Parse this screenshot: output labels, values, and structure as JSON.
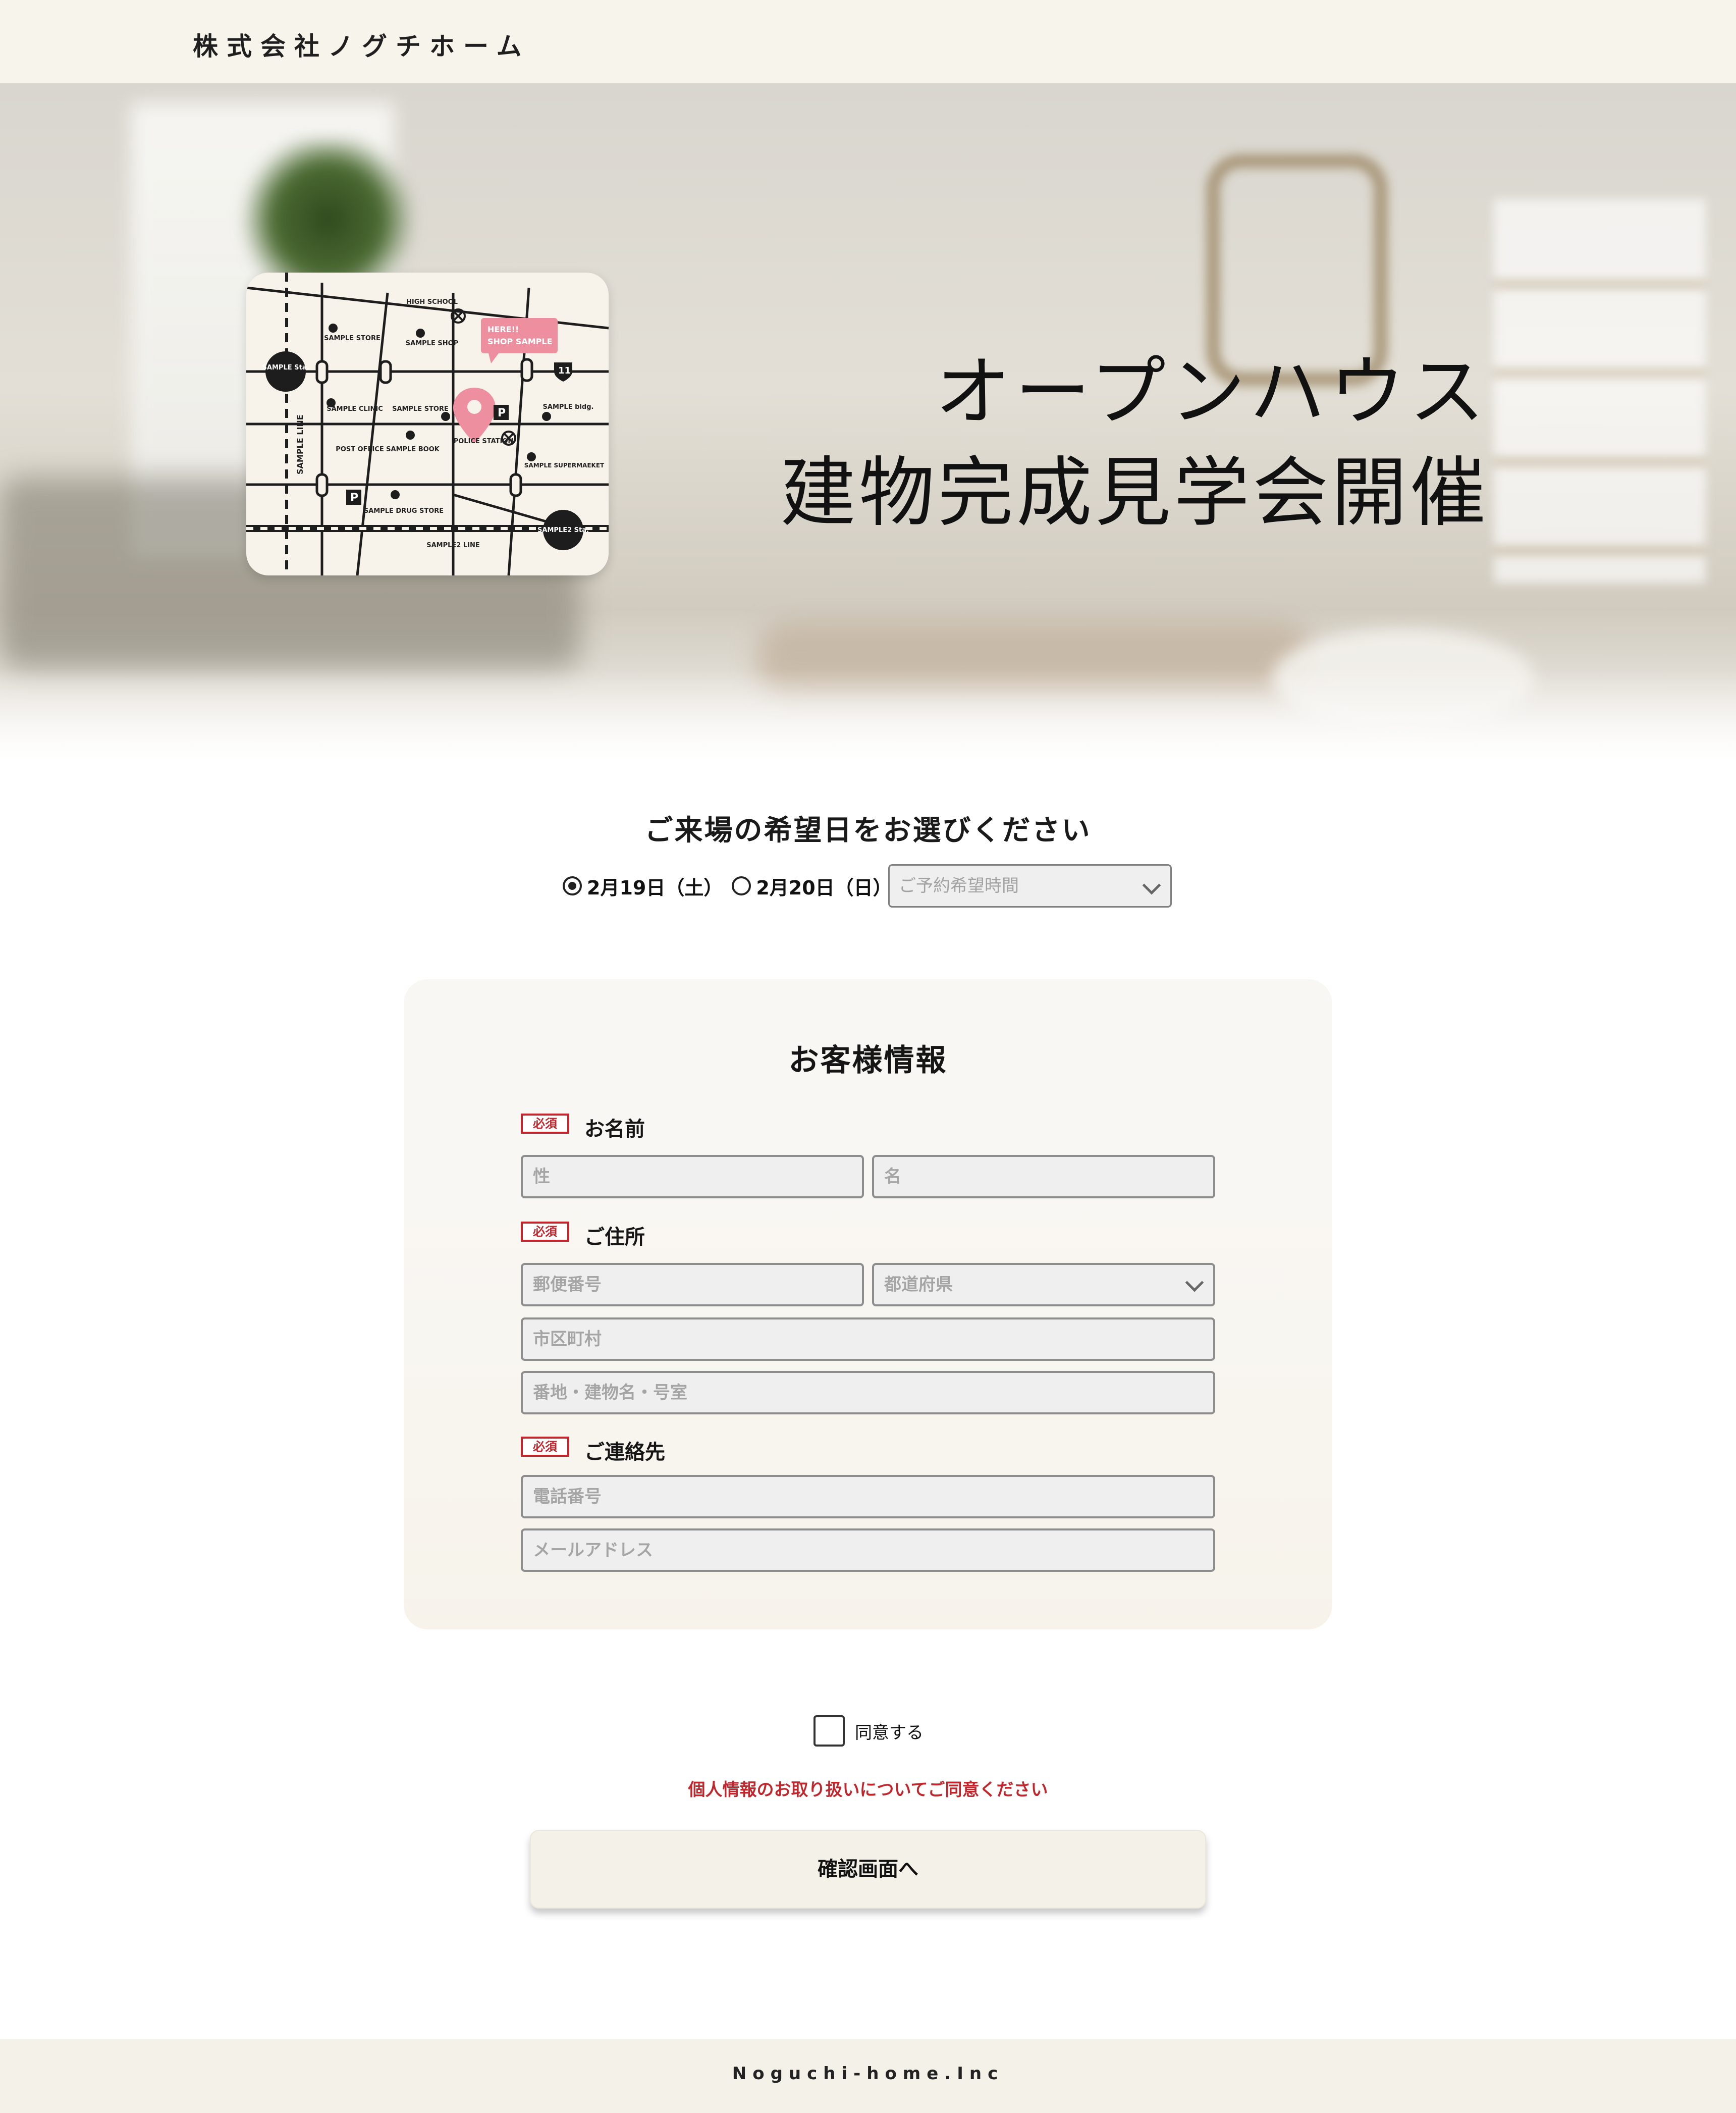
{
  "header": {
    "company": "株式会社ノグチホーム"
  },
  "hero": {
    "title_line1": "オープンハウス",
    "title_line2": "建物完成見学会開催"
  },
  "map": {
    "labels": {
      "high_school": "HIGH SCHOOL",
      "here": "HERE!!",
      "shop_sample": "SHOP SAMPLE",
      "sample_store": "SAMPLE STORE",
      "sample_shop": "SAMPLE SHOP",
      "sample_sta": "SAMPLE Sta.",
      "sample_clinic": "SAMPLE CLINIC",
      "sample_store2": "SAMPLE STORE",
      "sample_bldg": "SAMPLE bldg.",
      "sample_line": "SAMPLE LINE",
      "post_office": "POST OFFICE",
      "sample_book": "SAMPLE BOOK",
      "police_station": "POLICE STATION",
      "sample_supermarket": "SAMPLE SUPERMAEKET",
      "sample_drug_store": "SAMPLE DRUG STORE",
      "sample2_sta": "SAMPLE2 Sta.",
      "sample2_line": "SAMPLE2 LINE",
      "parking": "P",
      "route_number": "11"
    }
  },
  "date_section": {
    "title": "ご来場の希望日をお選びください",
    "options": [
      {
        "label": "2月19日（土）",
        "checked": true
      },
      {
        "label": "2月20日（日）",
        "checked": false
      }
    ],
    "time_placeholder": "ご予約希望時間"
  },
  "form": {
    "title": "お客様情報",
    "required_badge": "必須",
    "name": {
      "label": "お名前",
      "last_placeholder": "性",
      "first_placeholder": "名"
    },
    "address": {
      "label": "ご住所",
      "postal_placeholder": "郵便番号",
      "prefecture_placeholder": "都道府県",
      "city_placeholder": "市区町村",
      "street_placeholder": "番地・建物名・号室"
    },
    "contact": {
      "label": "ご連絡先",
      "phone_placeholder": "電話番号",
      "email_placeholder": "メールアドレス"
    }
  },
  "agreement": {
    "checkbox_label": "同意する",
    "notice": "個人情報のお取り扱いについてご同意ください"
  },
  "submit": {
    "label": "確認画面へ"
  },
  "footer": {
    "copyright": "Noguchi-home.Inc"
  },
  "colors": {
    "accent_red": "#c1272d",
    "cream": "#f7f4ec",
    "map_pin": "#ee8fa0"
  }
}
